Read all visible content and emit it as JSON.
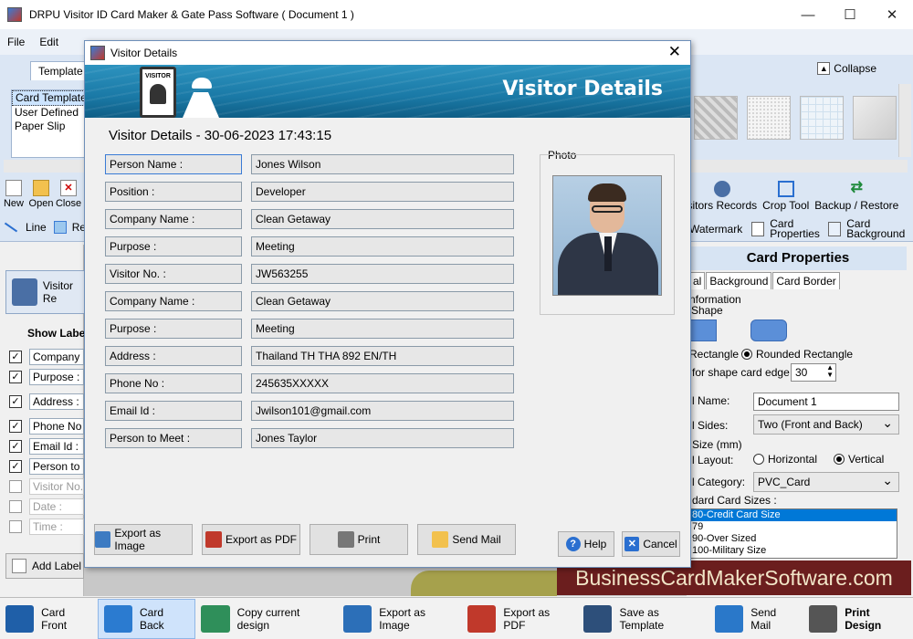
{
  "window": {
    "title": "DRPU Visitor ID Card Maker & Gate Pass Software ( Document 1 )",
    "minimize": "—",
    "maximize": "☐",
    "close": "✕"
  },
  "menu": [
    "File",
    "Edit"
  ],
  "ribbon": {
    "tab": "Template",
    "collapse": "Collapse",
    "template_list": [
      "Card Template",
      "User Defined",
      "Paper Slip"
    ],
    "tools_left": [
      "New",
      "Open",
      "Close"
    ],
    "tools_right": [
      "Visitors Records",
      "Crop Tool",
      "Backup / Restore"
    ],
    "row2_left": [
      "Line",
      "Rec"
    ],
    "row2_right": [
      "Watermark",
      "Card Properties",
      "Card Background"
    ]
  },
  "left_pane": {
    "visitor_button": "Visitor Re",
    "show_label": "Show Label",
    "items": [
      {
        "label": "Company",
        "checked": true
      },
      {
        "label": "Purpose :",
        "checked": true
      },
      {
        "label": "Address :",
        "checked": true
      },
      {
        "label": "Phone No",
        "checked": true
      },
      {
        "label": "Email Id :",
        "checked": true
      },
      {
        "label": "Person to",
        "checked": true
      },
      {
        "label": "Visitor No.",
        "checked": false
      },
      {
        "label": "Date :",
        "checked": false
      },
      {
        "label": "Time :",
        "checked": false
      }
    ],
    "add_label": "Add Label"
  },
  "dialog": {
    "title": "Visitor Details",
    "banner_title": "Visitor Details",
    "badge_text": "VISITOR",
    "heading": "Visitor Details - 30-06-2023 17:43:15",
    "fields": [
      {
        "label": "Person Name :",
        "value": "Jones Wilson"
      },
      {
        "label": "Position :",
        "value": "Developer"
      },
      {
        "label": "Company Name :",
        "value": "Clean Getaway"
      },
      {
        "label": "Purpose :",
        "value": "Meeting"
      },
      {
        "label": "Visitor No. :",
        "value": "JW563255"
      },
      {
        "label": "Company Name :",
        "value": "Clean Getaway"
      },
      {
        "label": "Purpose :",
        "value": "Meeting"
      },
      {
        "label": "Address :",
        "value": "Thailand TH THA 892 EN/TH"
      },
      {
        "label": "Phone No :",
        "value": "245635XXXXX"
      },
      {
        "label": "Email Id :",
        "value": "Jwilson101@gmail.com"
      },
      {
        "label": "Person to Meet :",
        "value": "Jones Taylor"
      }
    ],
    "photo_label": "Photo",
    "buttons": {
      "export_image": "Export as Image",
      "export_pdf": "Export as PDF",
      "print": "Print",
      "send_mail": "Send Mail",
      "help": "Help",
      "cancel": "Cancel"
    }
  },
  "card_properties": {
    "header": "Card Properties",
    "tabs": [
      "al",
      "Background",
      "Card Border"
    ],
    "information": "nformation",
    "shape": "Shape",
    "rectangle": "Rectangle",
    "rounded_rectangle": "Rounded Rectangle",
    "shape_edge_label": "for shape card edge :",
    "shape_edge_value": "30",
    "name_label": "l Name:",
    "name_value": "Document 1",
    "sides_label": "l Sides:",
    "sides_value": "Two (Front and Back)",
    "size_label": "Size (mm)",
    "layout_label": "l Layout:",
    "horizontal": "Horizontal",
    "vertical": "Vertical",
    "category_label": "l Category:",
    "category_value": "PVC_Card",
    "standard_sizes_label": "dard Card Sizes :",
    "sizes": [
      "80-Credit Card Size",
      "79",
      "90-Over Sized",
      "100-Military Size"
    ]
  },
  "watermark_banner": "BusinessCardMakerSoftware.com",
  "bottom_bar": [
    {
      "label": "Card Front",
      "active": false,
      "bold": false,
      "color": "#1f5fa8"
    },
    {
      "label": "Card Back",
      "active": true,
      "bold": false,
      "color": "#2b7bd0"
    },
    {
      "label": "Copy current design",
      "active": false,
      "bold": false,
      "color": "#2f8f5a"
    },
    {
      "label": "Export as Image",
      "active": false,
      "bold": false,
      "color": "#2c6fb8"
    },
    {
      "label": "Export as PDF",
      "active": false,
      "bold": false,
      "color": "#c0392b"
    },
    {
      "label": "Save as Template",
      "active": false,
      "bold": false,
      "color": "#2d4f7a"
    },
    {
      "label": "Send Mail",
      "active": false,
      "bold": false,
      "color": "#2a78c9"
    },
    {
      "label": "Print Design",
      "active": false,
      "bold": true,
      "color": "#555555"
    }
  ]
}
